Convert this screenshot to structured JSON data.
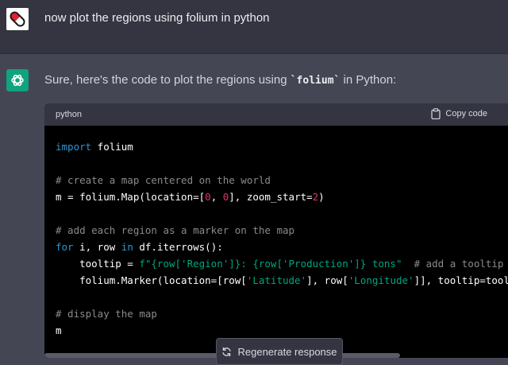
{
  "user": {
    "avatar_icon": "pill-capsule-icon",
    "message": "now plot the regions using folium in python"
  },
  "assistant": {
    "avatar_icon": "openai-logo-icon",
    "intro_prefix": "Sure, here's the code to plot the regions using ",
    "intro_code": "`folium`",
    "intro_suffix": " in Python:"
  },
  "code_block": {
    "language": "python",
    "copy_label": "Copy code",
    "copy_icon": "clipboard-icon",
    "lines": [
      [
        {
          "t": "import",
          "c": "kw"
        },
        {
          "t": " folium"
        }
      ],
      [],
      [
        {
          "t": "# create a map centered on the world",
          "c": "cm"
        }
      ],
      [
        {
          "t": "m = folium.Map(location=["
        },
        {
          "t": "0",
          "c": "num"
        },
        {
          "t": ", "
        },
        {
          "t": "0",
          "c": "num"
        },
        {
          "t": "], zoom_start="
        },
        {
          "t": "2",
          "c": "num"
        },
        {
          "t": ")"
        }
      ],
      [],
      [
        {
          "t": "# add each region as a marker on the map",
          "c": "cm"
        }
      ],
      [
        {
          "t": "for",
          "c": "kw"
        },
        {
          "t": " i, row "
        },
        {
          "t": "in",
          "c": "kw"
        },
        {
          "t": " df.iterrows():"
        }
      ],
      [
        {
          "t": "    tooltip = "
        },
        {
          "t": "f\"{row['Region']}: {row['Production']} tons\"",
          "c": "str"
        },
        {
          "t": "  "
        },
        {
          "t": "# add a tooltip",
          "c": "cm"
        }
      ],
      [
        {
          "t": "    folium.Marker(location=[row["
        },
        {
          "t": "'Latitude'",
          "c": "str"
        },
        {
          "t": "], row["
        },
        {
          "t": "'Longitude'",
          "c": "str"
        },
        {
          "t": "]], tooltip=tool"
        }
      ],
      [],
      [
        {
          "t": "# display the map",
          "c": "cm"
        }
      ],
      [
        {
          "t": "m"
        }
      ]
    ]
  },
  "regenerate": {
    "label": "Regenerate response",
    "icon": "refresh-icon"
  }
}
